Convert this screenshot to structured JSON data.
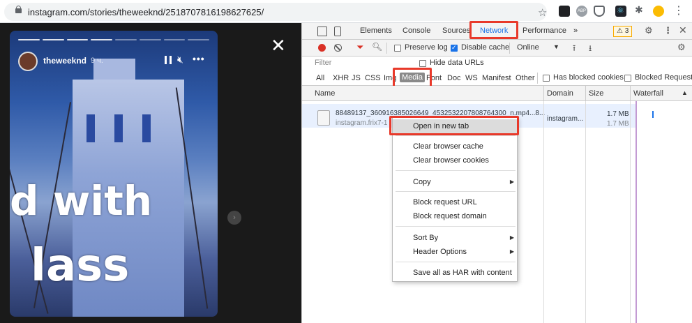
{
  "browser": {
    "url": "instagram.com/stories/theweeknd/2518707816198627625/"
  },
  "story": {
    "username": "theweeknd",
    "time": "9 ч.",
    "text_line1": "d with",
    "text_line2": "lass"
  },
  "devtools": {
    "tabs": [
      "Elements",
      "Console",
      "Sources",
      "Network",
      "Performance"
    ],
    "more_tabs": "»",
    "warnings_count": "3",
    "toolbar": {
      "preserve_log": "Preserve log",
      "disable_cache": "Disable cache",
      "throttle": "Online"
    },
    "filter_placeholder": "Filter",
    "hide_data_urls": "Hide data URLs",
    "types": [
      "All",
      "XHR",
      "JS",
      "CSS",
      "Img",
      "Media",
      "Font",
      "Doc",
      "WS",
      "Manifest",
      "Other"
    ],
    "has_blocked_cookies": "Has blocked cookies",
    "blocked_requests": "Blocked Requests",
    "columns": [
      "Name",
      "Domain",
      "Size",
      "Waterfall"
    ],
    "request": {
      "name": "88489137_360916385026649_4532532207808764300_n.mp4...8...",
      "host": "instagram.frix7-1",
      "domain": "instagram...",
      "size": "1.7 MB",
      "transferred": "1.7 MB"
    }
  },
  "context_menu": {
    "items": [
      "Open in new tab",
      "Clear browser cache",
      "Clear browser cookies",
      "Copy",
      "Block request URL",
      "Block request domain",
      "Sort By",
      "Header Options",
      "Save all as HAR with content"
    ]
  },
  "colors": {
    "highlight": "#e8392a",
    "active_tab": "#1a73e8"
  }
}
